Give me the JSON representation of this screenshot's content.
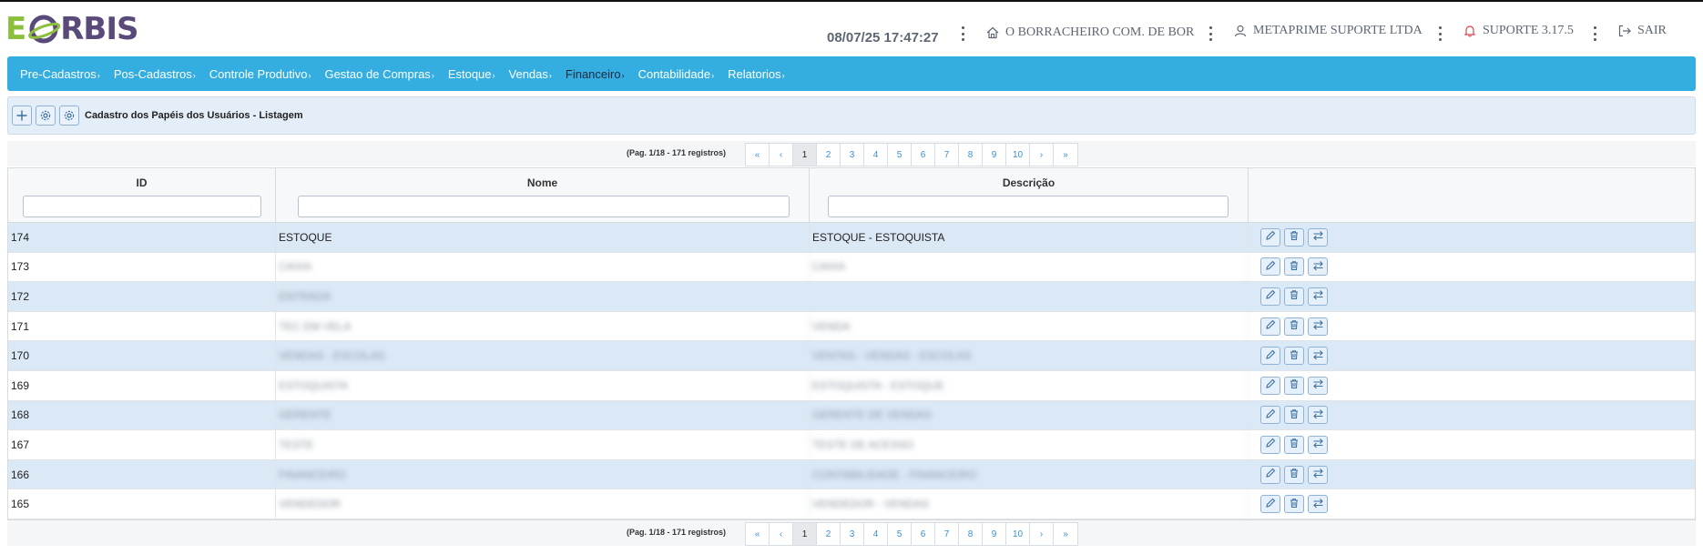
{
  "header": {
    "logo": "EORBIS",
    "datetime": "08/07/25 17:47:27",
    "company": "O BORRACHEIRO COM. DE BOR",
    "user": "METAPRIME SUPORTE LTDA",
    "support": "SUPORTE 3.17.5",
    "logout": "SAIR"
  },
  "nav": {
    "items": [
      {
        "label": "Pre-Cadastros"
      },
      {
        "label": "Pos-Cadastros"
      },
      {
        "label": "Controle Produtivo"
      },
      {
        "label": "Gestao de Compras"
      },
      {
        "label": "Estoque"
      },
      {
        "label": "Vendas"
      },
      {
        "label": "Financeiro"
      },
      {
        "label": "Contabilidade"
      },
      {
        "label": "Relatorios"
      }
    ],
    "caret": "›"
  },
  "toolbar": {
    "title": "Cadastro dos Papéis dos Usuários - Listagem"
  },
  "pagination": {
    "info": "(Pag. 1/18 - 171 registros)",
    "first": "«",
    "prev": "‹",
    "pages": [
      "1",
      "2",
      "3",
      "4",
      "5",
      "6",
      "7",
      "8",
      "9",
      "10"
    ],
    "next": "›",
    "last": "»",
    "current": "1"
  },
  "table": {
    "columns": {
      "id": "ID",
      "nome": "Nome",
      "descricao": "Descrição"
    },
    "rows": [
      {
        "id": "174",
        "nome": "ESTOQUE",
        "descricao": "ESTOQUE - ESTOQUISTA",
        "blurred": false
      },
      {
        "id": "173",
        "nome": "CAIXA",
        "descricao": "CAIXA",
        "blurred": true
      },
      {
        "id": "172",
        "nome": "ENTRADA",
        "descricao": "",
        "blurred": true
      },
      {
        "id": "171",
        "nome": "TEC EM VELA",
        "descricao": "VENDA",
        "blurred": true
      },
      {
        "id": "170",
        "nome": "VENDAS - ESCOLAS",
        "descricao": "VENTAS - VENDAS - ESCOLAS",
        "blurred": true
      },
      {
        "id": "169",
        "nome": "ESTOQUISTA",
        "descricao": "ESTOQUISTA - ESTOQUE",
        "blurred": true
      },
      {
        "id": "168",
        "nome": "GERENTE",
        "descricao": "GERENTE DE VENDAS",
        "blurred": true
      },
      {
        "id": "167",
        "nome": "TESTE",
        "descricao": "TESTE DE ACESSO",
        "blurred": true
      },
      {
        "id": "166",
        "nome": "FINANCEIRO",
        "descricao": "CONTABILIDADE - FINANCEIRO",
        "blurred": true
      },
      {
        "id": "165",
        "nome": "VENDEDOR",
        "descricao": "VENDEDOR - VENDAS",
        "blurred": true
      }
    ]
  }
}
